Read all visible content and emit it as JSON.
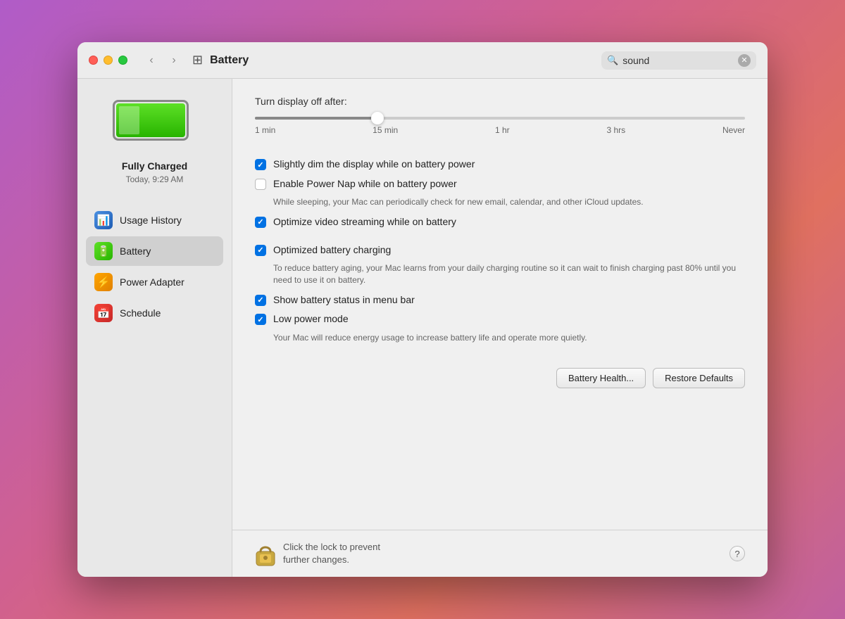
{
  "window": {
    "title": "Battery",
    "search_placeholder": "sound",
    "search_value": "sound"
  },
  "traffic_lights": {
    "close_label": "Close",
    "minimize_label": "Minimize",
    "maximize_label": "Maximize"
  },
  "nav": {
    "back_label": "‹",
    "forward_label": "›",
    "grid_label": "⊞"
  },
  "sidebar": {
    "battery_status": "Fully Charged",
    "battery_time": "Today, 9:29 AM",
    "items": [
      {
        "id": "usage-history",
        "label": "Usage History",
        "icon": "📊"
      },
      {
        "id": "battery",
        "label": "Battery",
        "icon": "🔋",
        "active": true
      },
      {
        "id": "power-adapter",
        "label": "Power Adapter",
        "icon": "⚡"
      },
      {
        "id": "schedule",
        "label": "Schedule",
        "icon": "📅"
      }
    ]
  },
  "detail": {
    "slider_label": "Turn display off after:",
    "slider_marks": [
      "1 min",
      "15 min",
      "1 hr",
      "3 hrs",
      "Never"
    ],
    "slider_value_pct": 25,
    "checkboxes": [
      {
        "id": "dim-display",
        "checked": true,
        "label": "Slightly dim the display while on battery power",
        "subtext": null
      },
      {
        "id": "power-nap",
        "checked": false,
        "label": "Enable Power Nap while on battery power",
        "subtext": "While sleeping, your Mac can periodically check for new email, calendar, and other iCloud updates."
      },
      {
        "id": "video-streaming",
        "checked": true,
        "label": "Optimize video streaming while on battery",
        "subtext": null
      },
      {
        "id": "optimized-charging",
        "checked": true,
        "label": "Optimized battery charging",
        "subtext": "To reduce battery aging, your Mac learns from your daily charging routine so it can wait to finish charging past 80% until you need to use it on battery."
      },
      {
        "id": "menu-bar",
        "checked": true,
        "label": "Show battery status in menu bar",
        "subtext": null
      },
      {
        "id": "low-power",
        "checked": true,
        "label": "Low power mode",
        "subtext": "Your Mac will reduce energy usage to increase battery life and operate more quietly."
      }
    ],
    "buttons": {
      "battery_health": "Battery Health...",
      "restore_defaults": "Restore Defaults"
    },
    "lock_text": "Click the lock to prevent\nfurther changes.",
    "help_label": "?"
  }
}
